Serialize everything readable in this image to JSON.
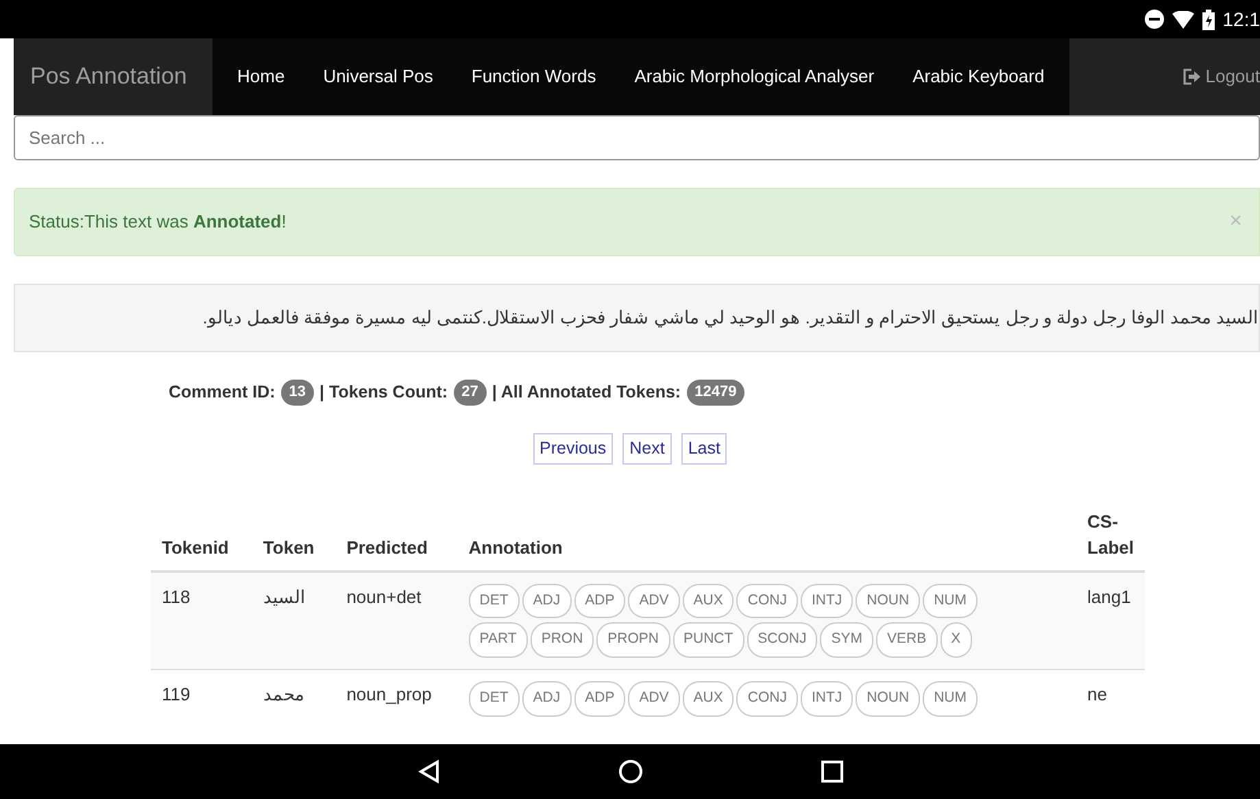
{
  "status_bar": {
    "time": "12:1"
  },
  "navbar": {
    "brand": "Pos Annotation",
    "items": [
      {
        "label": "Home"
      },
      {
        "label": "Universal Pos"
      },
      {
        "label": "Function Words"
      },
      {
        "label": "Arabic Morphological Analyser"
      },
      {
        "label": "Arabic Keyboard"
      }
    ],
    "logout": "Logout"
  },
  "search": {
    "placeholder": "Search ..."
  },
  "alert": {
    "text": "Status:This text was **Annotated**!",
    "close": "×"
  },
  "comment_text": "السيد محمد الوفا رجل دولة و رجل يستحيق الاحترام و التقدير. هو الوحيد لي ماشي شفار فحزب الاستقلال.كنتمى ليه مسيرة موفقة فالعمل ديالو.",
  "info": [
    {
      "label": "Comment ID:",
      "badge": "13"
    },
    {
      "label": "| Tokens Count:",
      "badge": "27"
    },
    {
      "label": "| All Annotated Tokens:",
      "badge": "12479"
    }
  ],
  "pagination": [
    {
      "label": "Previous"
    },
    {
      "label": "Next"
    },
    {
      "label": "Last"
    }
  ],
  "table": {
    "columns": [
      "Tokenid",
      "Token",
      "Predicted",
      "Annotation",
      "CS-Label"
    ],
    "rows": [
      {
        "tokenid": "118",
        "token": "السيد",
        "predicted": "noun+det",
        "cs_label": "lang1",
        "tags": [
          {
            "label": "DET",
            "selected": false
          },
          {
            "label": "ADJ",
            "selected": false
          },
          {
            "label": "ADP",
            "selected": false
          },
          {
            "label": "ADV",
            "selected": false
          },
          {
            "label": "AUX",
            "selected": false
          },
          {
            "label": "CONJ",
            "selected": false
          },
          {
            "label": "INTJ",
            "selected": false
          },
          {
            "label": "NOUN",
            "selected": false
          },
          {
            "label": "NUM",
            "selected": false
          },
          {
            "label": "PART",
            "selected": false
          },
          {
            "label": "PRON",
            "selected": false
          },
          {
            "label": "PROPN",
            "selected": false
          },
          {
            "label": "PUNCT",
            "selected": false
          },
          {
            "label": "SCONJ",
            "selected": false
          },
          {
            "label": "SYM",
            "selected": false
          },
          {
            "label": "VERB",
            "selected": false
          },
          {
            "label": "X",
            "selected": false
          }
        ]
      },
      {
        "tokenid": "119",
        "token": "محمد",
        "predicted": "noun_prop",
        "cs_label": "ne",
        "tags": [
          {
            "label": "DET",
            "selected": false
          },
          {
            "label": "ADJ",
            "selected": false
          },
          {
            "label": "ADP",
            "selected": false
          },
          {
            "label": "ADV",
            "selected": false
          },
          {
            "label": "AUX",
            "selected": false
          },
          {
            "label": "CONJ",
            "selected": false
          },
          {
            "label": "INTJ",
            "selected": false
          },
          {
            "label": "NOUN",
            "selected": false
          },
          {
            "label": "NUM",
            "selected": false
          }
        ]
      }
    ]
  }
}
